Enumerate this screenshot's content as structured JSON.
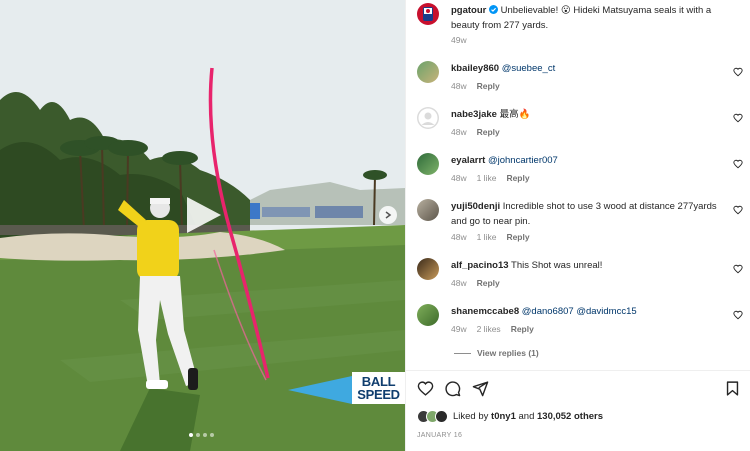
{
  "post": {
    "author": "pgatour",
    "caption": "Unbelievable! 😮 Hideki Matsuyama seals it with a beauty from 277 yards.",
    "age": "49w",
    "avatar_icon": "pga-tour-logo",
    "verified_icon": "verified-badge-icon"
  },
  "media": {
    "graphic_line1": "BALL",
    "graphic_line2": "SPEED",
    "slide_count": 4,
    "active_slide": 1,
    "play_icon": "play-icon",
    "next_icon": "chevron-right-icon",
    "colors": {
      "tracer": "#e8246c",
      "arrow": "#3fa9e0",
      "shirt": "#f1d21a",
      "grass": "#5f8a3c"
    }
  },
  "comments": [
    {
      "user": "kbailey860",
      "text": "",
      "mention": "@suebee_ct",
      "age": "48w",
      "likes": "",
      "reply": "Reply"
    },
    {
      "user": "nabe3jake",
      "text": "最高🔥",
      "mention": "",
      "age": "48w",
      "likes": "",
      "reply": "Reply"
    },
    {
      "user": "eyalarrt",
      "text": "",
      "mention": "@johncartier007",
      "age": "48w",
      "likes": "1 like",
      "reply": "Reply"
    },
    {
      "user": "yuji50denji",
      "text": "Incredible shot to use 3 wood at distance 277yards and go to near pin.",
      "mention": "",
      "age": "48w",
      "likes": "1 like",
      "reply": "Reply"
    },
    {
      "user": "alf_pacino13",
      "text": "This Shot was unreal!",
      "mention": "",
      "age": "48w",
      "likes": "",
      "reply": "Reply"
    },
    {
      "user": "shanemccabe8",
      "text": "",
      "mention": "@dano6807 @davidmcc15",
      "age": "49w",
      "likes": "2 likes",
      "reply": "Reply"
    }
  ],
  "view_replies": "View replies (1)",
  "actions": {
    "like_icon": "heart-icon",
    "comment_icon": "comment-icon",
    "share_icon": "share-icon",
    "save_icon": "bookmark-icon"
  },
  "likes": {
    "prefix": "Liked by",
    "user": "t0ny1",
    "joiner": "and",
    "count": "130,052 others"
  },
  "date": "JANUARY 16"
}
